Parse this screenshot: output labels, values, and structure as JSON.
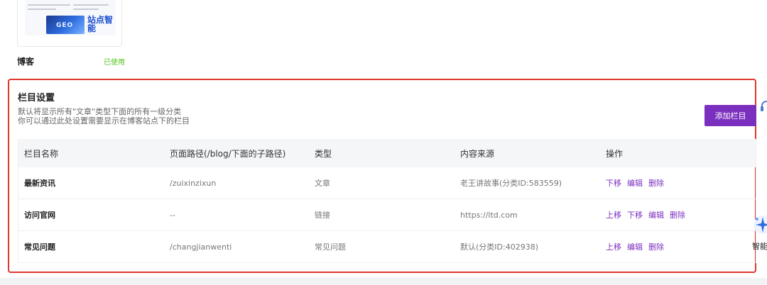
{
  "template_card": {
    "thumbnail_text": "站点智能",
    "thumbnail_badge": "GEO",
    "name": "博客",
    "status": "已使用"
  },
  "section": {
    "title": "栏目设置",
    "desc_line1": "默认将显示所有\"文章\"类型下面的所有一级分类",
    "desc_line2": "你可以通过此处设置需要显示在博客站点下的栏目",
    "add_button": "添加栏目"
  },
  "table": {
    "headers": [
      "栏目名称",
      "页面路径(/blog/下面的子路径)",
      "类型",
      "内容来源",
      "操作"
    ],
    "rows": [
      {
        "name": "最新资讯",
        "path": "/zuixinzixun",
        "type": "文章",
        "source": "老王讲故事(分类ID:583559)",
        "ops": [
          "下移",
          "编辑",
          "删除"
        ]
      },
      {
        "name": "访问官网",
        "path": "--",
        "type": "链接",
        "source": "https://ltd.com",
        "ops": [
          "上移",
          "下移",
          "编辑",
          "删除"
        ]
      },
      {
        "name": "常见问题",
        "path": "/changjianwenti",
        "type": "常见问题",
        "source": "默认(分类ID:402938)",
        "ops": [
          "上移",
          "编辑",
          "删除"
        ]
      }
    ]
  },
  "floating": {
    "smart_label": "智能"
  },
  "colors": {
    "accent": "#7b2fbf",
    "highlight_border": "#e0362c",
    "status_green": "#52c41a"
  }
}
